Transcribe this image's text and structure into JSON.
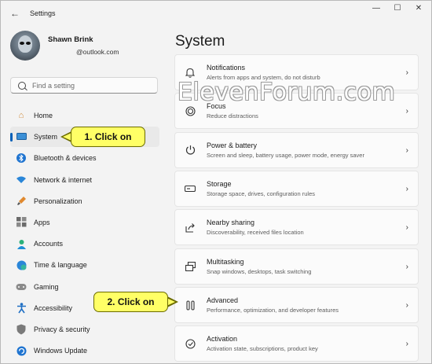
{
  "window": {
    "title": "Settings",
    "controls": [
      "—",
      "☐",
      "✕"
    ]
  },
  "profile": {
    "name": "Shawn Brink",
    "email": "@outlook.com"
  },
  "search": {
    "placeholder": "Find a setting"
  },
  "nav": {
    "items": [
      {
        "label": "Home",
        "icon": "home-icon"
      },
      {
        "label": "System",
        "icon": "display-icon",
        "selected": true
      },
      {
        "label": "Bluetooth & devices",
        "icon": "bluetooth-icon"
      },
      {
        "label": "Network & internet",
        "icon": "wifi-icon"
      },
      {
        "label": "Personalization",
        "icon": "paintbrush-icon"
      },
      {
        "label": "Apps",
        "icon": "apps-icon"
      },
      {
        "label": "Accounts",
        "icon": "person-icon"
      },
      {
        "label": "Time & language",
        "icon": "globe-clock-icon"
      },
      {
        "label": "Gaming",
        "icon": "gamepad-icon"
      },
      {
        "label": "Accessibility",
        "icon": "accessibility-icon"
      },
      {
        "label": "Privacy & security",
        "icon": "shield-icon"
      },
      {
        "label": "Windows Update",
        "icon": "update-icon"
      }
    ]
  },
  "main": {
    "title": "System",
    "cards": [
      {
        "title": "Notifications",
        "desc": "Alerts from apps and system, do not disturb",
        "icon": "bell-icon"
      },
      {
        "title": "Focus",
        "desc": "Reduce distractions",
        "icon": "focus-icon"
      },
      {
        "title": "Power & battery",
        "desc": "Screen and sleep, battery usage, power mode, energy saver",
        "icon": "power-icon"
      },
      {
        "title": "Storage",
        "desc": "Storage space, drives, configuration rules",
        "icon": "storage-icon"
      },
      {
        "title": "Nearby sharing",
        "desc": "Discoverability, received files location",
        "icon": "share-icon"
      },
      {
        "title": "Multitasking",
        "desc": "Snap windows, desktops, task switching",
        "icon": "multitasking-icon"
      },
      {
        "title": "Advanced",
        "desc": "Performance, optimization, and developer features",
        "icon": "advanced-icon"
      },
      {
        "title": "Activation",
        "desc": "Activation state, subscriptions, product key",
        "icon": "activation-icon"
      }
    ]
  },
  "watermark": "ElevenForum.com",
  "callouts": {
    "step1": "1. Click on",
    "step2": "2. Click on"
  },
  "colors": {
    "accent": "#005fb8",
    "callout_fill": "#ffff66"
  }
}
